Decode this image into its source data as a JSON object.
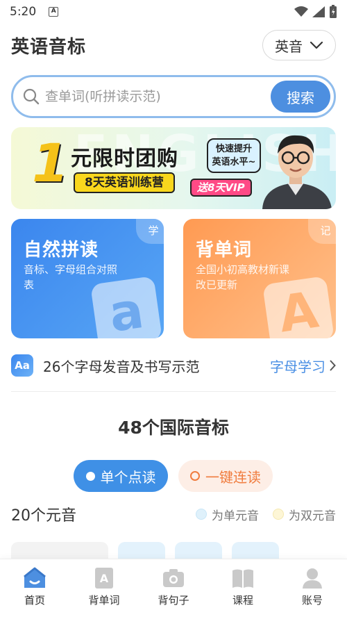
{
  "status_bar": {
    "time": "5:20",
    "notification_icon": "A"
  },
  "header": {
    "title": "英语音标",
    "accent_selector": {
      "value": "英音",
      "icon": "chevron-down-icon"
    }
  },
  "search": {
    "placeholder": "查单词(听拼读示范)",
    "button_label": "搜索"
  },
  "banner": {
    "watermark": "ENGLISH",
    "big_number": "1",
    "headline": "元限时团购",
    "subline": "8天英语训练营",
    "bubble_line1": "快速提升",
    "bubble_line2": "英语水平~",
    "vip_badge": "送8天VIP"
  },
  "cards": [
    {
      "title": "自然拼读",
      "subtitle": "音标、字母组合对照表",
      "corner": "学",
      "deco_letter": "a",
      "color": "#3b86ee"
    },
    {
      "title": "背单词",
      "subtitle": "全国小初高教材新课改已更新",
      "corner": "记",
      "deco_letter": "A",
      "color": "#ff9a52"
    }
  ],
  "alphabet": {
    "icon_text": "Aa",
    "text": "26个字母发音及书写示范",
    "link": "字母学习"
  },
  "ipa": {
    "title": "48个国际音标"
  },
  "modes": {
    "single": "单个点读",
    "continuous": "一键连读"
  },
  "vowels": {
    "title": "20个元音",
    "legend": [
      {
        "label": "为单元音",
        "color": "#dff1fb"
      },
      {
        "label": "为双元音",
        "color": "#fdf6d6"
      }
    ]
  },
  "bottom_nav": [
    {
      "label": "首页",
      "icon": "home-icon",
      "active": true
    },
    {
      "label": "背单词",
      "icon": "word-card-icon",
      "active": false
    },
    {
      "label": "背句子",
      "icon": "camera-icon",
      "active": false
    },
    {
      "label": "课程",
      "icon": "book-icon",
      "active": false
    },
    {
      "label": "账号",
      "icon": "user-icon",
      "active": false
    }
  ],
  "colors": {
    "accent": "#4d8fe0",
    "orange": "#f07c3e"
  }
}
